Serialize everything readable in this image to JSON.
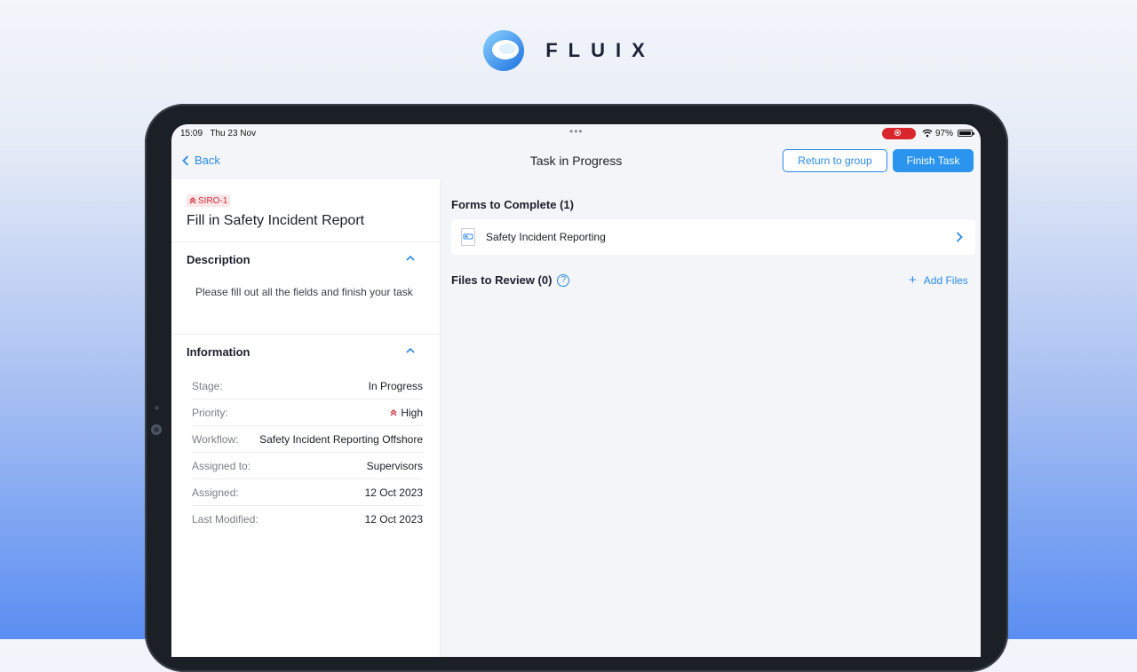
{
  "brand": {
    "name": "FLUIX"
  },
  "status_bar": {
    "time": "15:09",
    "date": "Thu 23 Nov",
    "battery": "97%"
  },
  "nav": {
    "back_label": "Back",
    "title": "Task in Progress",
    "return_label": "Return to group",
    "finish_label": "Finish Task"
  },
  "task": {
    "id": "SIRO-1",
    "title": "Fill in Safety Incident Report",
    "description_header": "Description",
    "description": "Please fill out all the fields and finish your task",
    "information_header": "Information",
    "info": [
      {
        "key": "Stage:",
        "value": "In Progress"
      },
      {
        "key": "Priority:",
        "value": "High"
      },
      {
        "key": "Workflow:",
        "value": "Safety Incident Reporting Offshore"
      },
      {
        "key": "Assigned to:",
        "value": "Supervisors"
      },
      {
        "key": "Assigned:",
        "value": "12 Oct 2023"
      },
      {
        "key": "Last Modified:",
        "value": "12 Oct 2023"
      }
    ]
  },
  "forms": {
    "title": "Forms to Complete (1)",
    "items": [
      {
        "label": "Safety Incident Reporting"
      }
    ]
  },
  "files": {
    "title": "Files to Review (0)",
    "help": "?",
    "add_label": "Add Files"
  },
  "colors": {
    "accent": "#2a8ae6",
    "priority": "#d32f3a"
  }
}
